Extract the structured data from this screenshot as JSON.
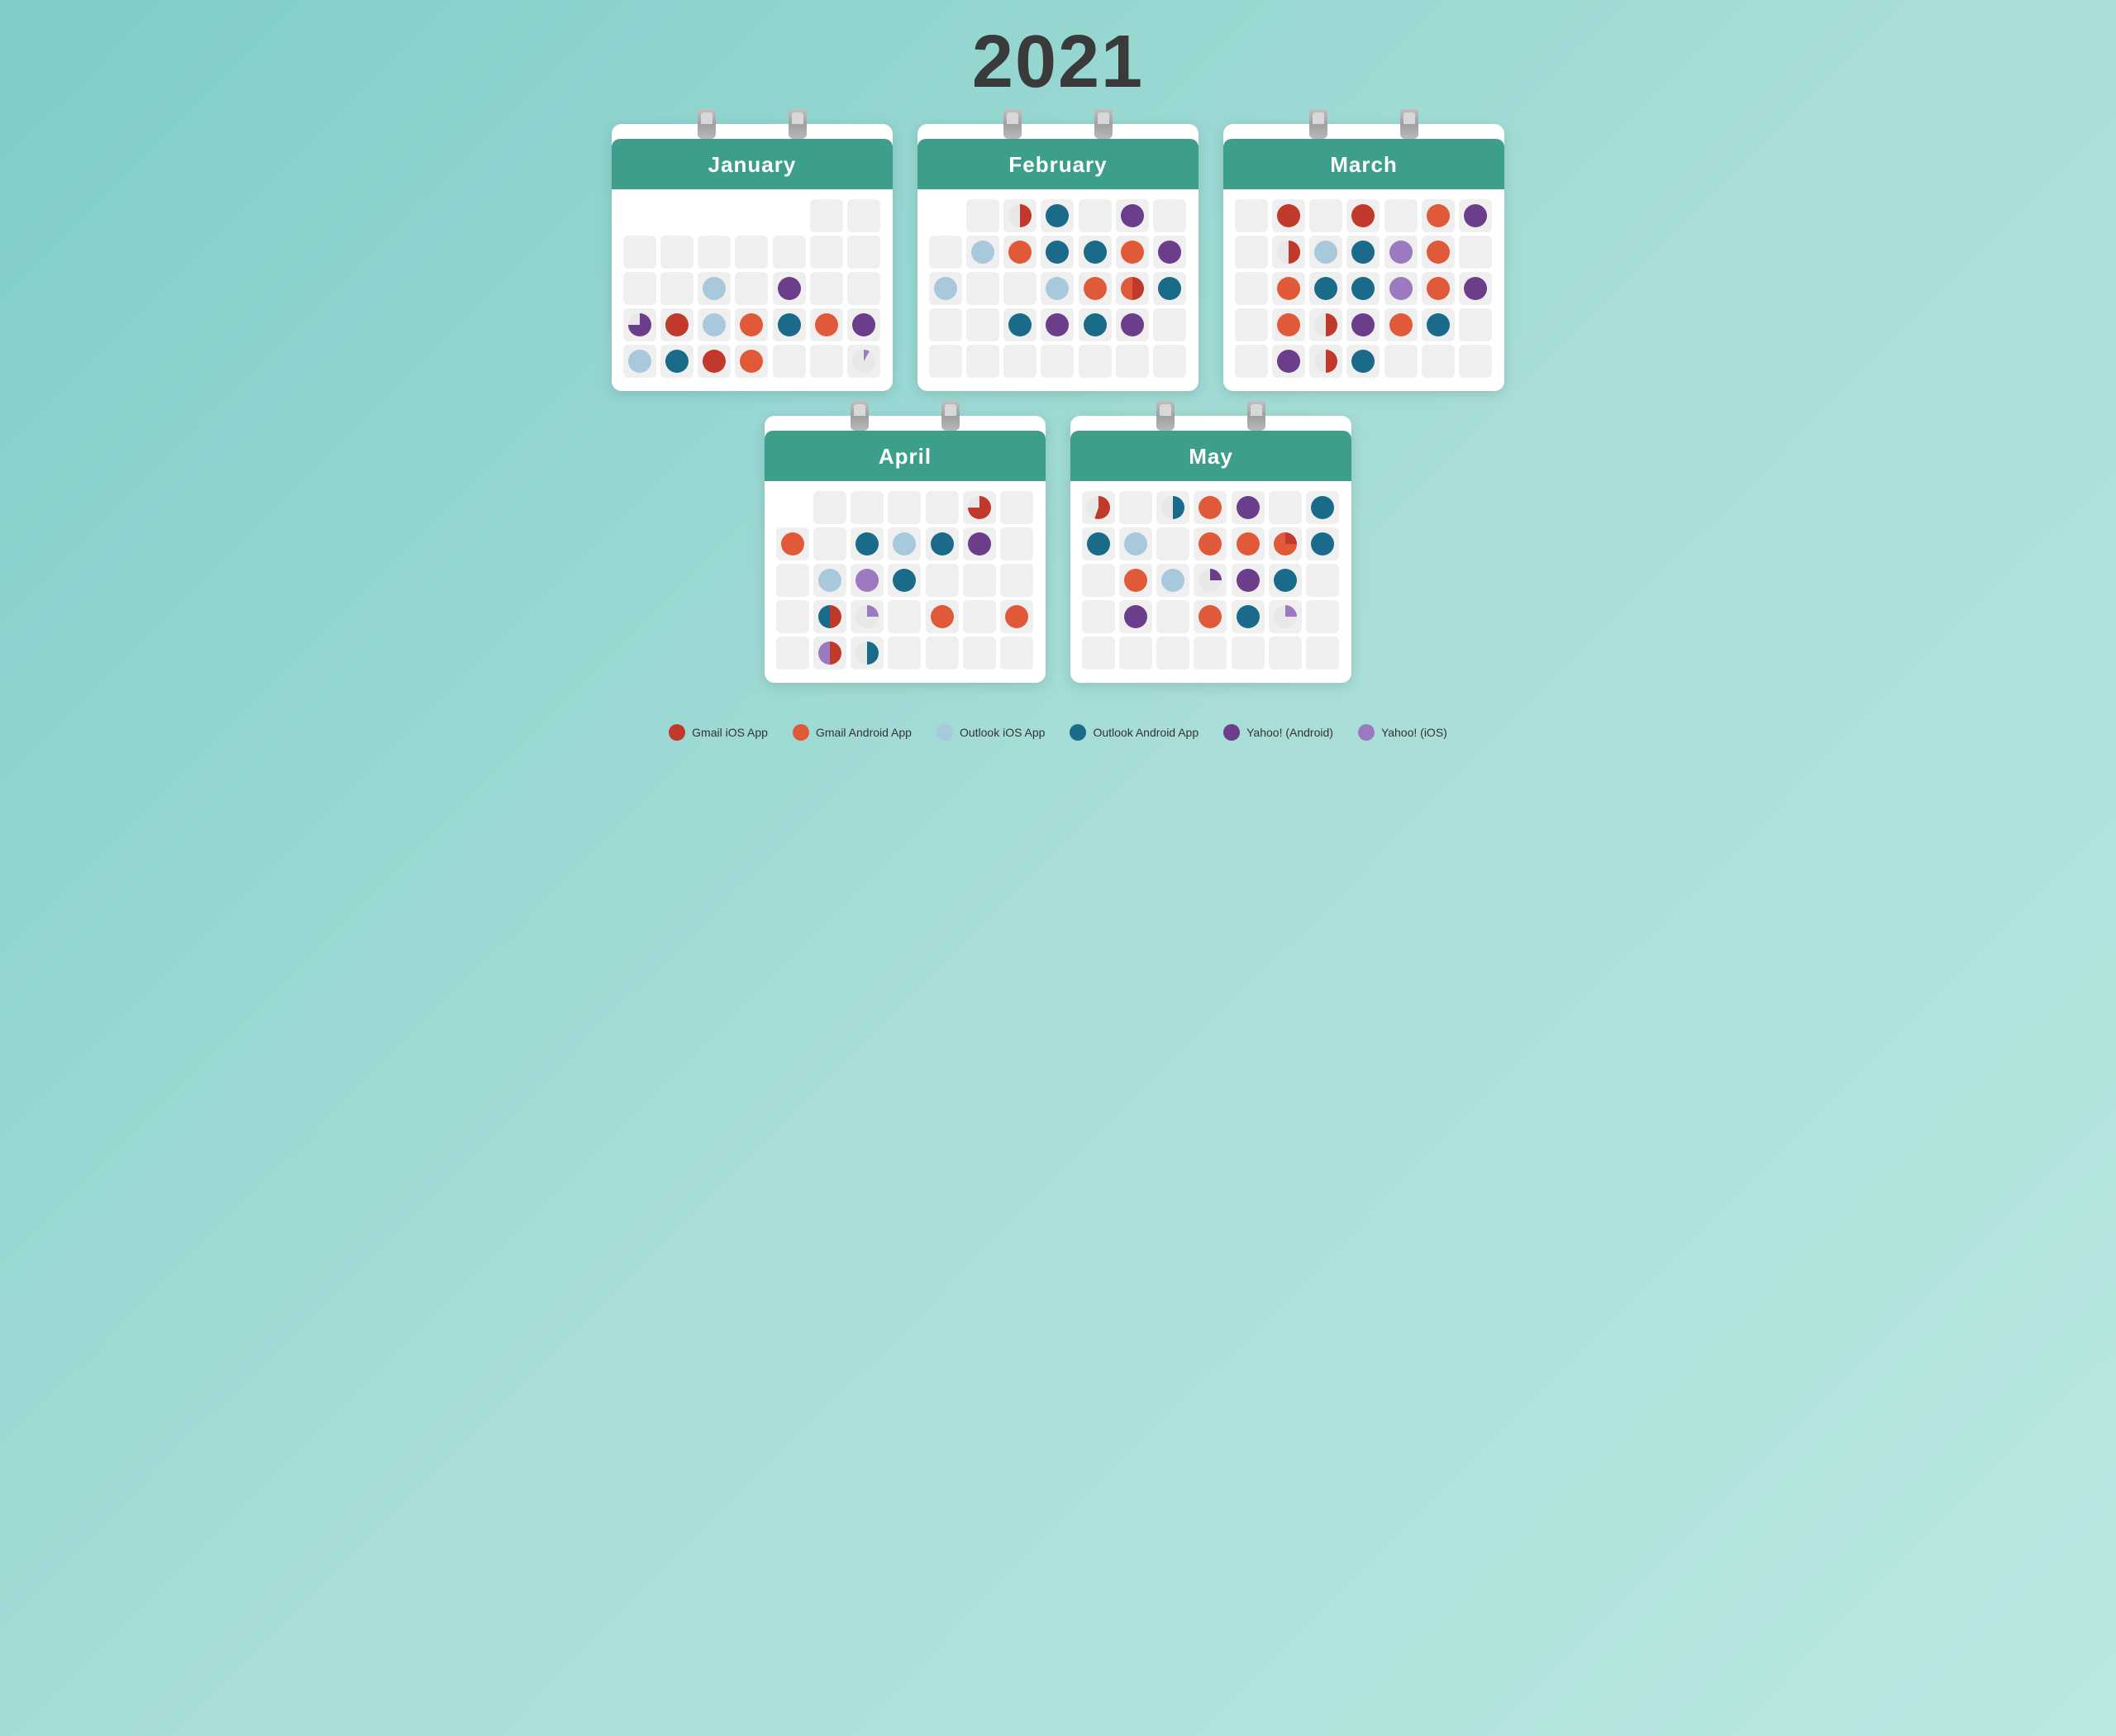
{
  "title": "2021",
  "header_color": "#3d9e8c",
  "background": "#7ecdc8",
  "months": [
    {
      "name": "January",
      "id": "january",
      "rows": [
        [
          "empty",
          "empty",
          "empty",
          "empty",
          "empty",
          "empty",
          "empty"
        ],
        [
          "empty",
          "empty",
          "empty",
          "empty",
          "empty",
          "empty",
          "empty"
        ],
        [
          "empty",
          "empty",
          "ol-ios",
          "empty",
          "yah-android",
          "empty",
          "empty"
        ],
        [
          "yah-android-small",
          "gm-ios",
          "ol-ios",
          "gm-android",
          "ol-android",
          "gm-android",
          "yah-android"
        ],
        [
          "ol-ios",
          "ol-android",
          "gm-ios",
          "gm-android",
          "empty",
          "empty",
          "yah-ios-tiny"
        ]
      ]
    },
    {
      "name": "February",
      "id": "february",
      "rows": [
        [
          "empty",
          "empty",
          "gm-ios-half",
          "ol-android",
          "empty",
          "yah-android",
          "empty"
        ],
        [
          "empty",
          "ol-ios",
          "gm-android",
          "ol-android",
          "ol-android",
          "gm-android",
          "yah-android"
        ],
        [
          "ol-ios",
          "empty",
          "empty",
          "ol-ios",
          "gm-android",
          "gm-ios-half",
          "ol-android"
        ],
        [
          "empty",
          "empty",
          "ol-android",
          "yah-android",
          "ol-android",
          "yah-android",
          "empty"
        ],
        [
          "empty",
          "empty",
          "empty",
          "empty",
          "empty",
          "empty",
          "empty"
        ]
      ]
    },
    {
      "name": "March",
      "id": "march",
      "rows": [
        [
          "empty",
          "gm-ios",
          "empty",
          "gm-ios",
          "empty",
          "gm-android",
          "yah-android"
        ],
        [
          "empty",
          "gm-ios-half",
          "ol-ios",
          "ol-android",
          "yah-ios",
          "gm-android",
          "empty"
        ],
        [
          "empty",
          "gm-android",
          "ol-android",
          "ol-android",
          "yah-ios",
          "gm-android",
          "yah-android"
        ],
        [
          "empty",
          "gm-android",
          "gm-ios-half",
          "yah-android",
          "gm-android",
          "ol-android",
          "empty"
        ],
        [
          "empty",
          "yah-android",
          "gm-ios-half",
          "ol-android",
          "empty",
          "empty",
          "empty"
        ]
      ]
    },
    {
      "name": "April",
      "id": "april",
      "rows": [
        [
          "empty",
          "empty",
          "empty",
          "empty",
          "empty",
          "gm-ios-small",
          "empty"
        ],
        [
          "gm-android",
          "empty",
          "ol-android",
          "ol-ios",
          "ol-android",
          "yah-android",
          "empty"
        ],
        [
          "empty",
          "ol-ios",
          "yah-ios",
          "ol-android",
          "empty",
          "empty",
          "empty"
        ],
        [
          "empty",
          "gm-ios-half",
          "yah-ios-small",
          "empty",
          "gm-android",
          "empty",
          "gm-android"
        ],
        [
          "empty",
          "gm-ios-half",
          "ol-android-small",
          "empty",
          "empty",
          "empty",
          "empty"
        ]
      ]
    },
    {
      "name": "May",
      "id": "may",
      "rows": [
        [
          "gm-ios-half",
          "empty",
          "ol-android-half",
          "gm-android",
          "yah-android",
          "empty",
          "ol-android"
        ],
        [
          "ol-android",
          "ol-ios",
          "empty",
          "gm-android",
          "gm-android",
          "gm-ios-pie",
          "ol-android"
        ],
        [
          "empty",
          "gm-android",
          "ol-ios",
          "yah-android-small",
          "yah-android",
          "ol-android",
          "empty"
        ],
        [
          "empty",
          "yah-android",
          "empty",
          "gm-android",
          "ol-android",
          "yah-ios-small",
          "empty"
        ],
        [
          "empty",
          "empty",
          "empty",
          "empty",
          "empty",
          "empty",
          "empty"
        ]
      ]
    }
  ],
  "legend": [
    {
      "id": "gmail-ios",
      "label": "Gmail iOS App",
      "color": "#c0392b"
    },
    {
      "id": "gmail-android",
      "label": "Gmail Android App",
      "color": "#e05a3a"
    },
    {
      "id": "outlook-ios",
      "label": "Outlook iOS App",
      "color": "#a8c8dc"
    },
    {
      "id": "outlook-android",
      "label": "Outlook Android App",
      "color": "#1a6b8a"
    },
    {
      "id": "yahoo-android",
      "label": "Yahoo! (Android)",
      "color": "#6b3d8a"
    },
    {
      "id": "yahoo-ios",
      "label": "Yahoo! (iOS)",
      "color": "#9b7ac0"
    }
  ]
}
